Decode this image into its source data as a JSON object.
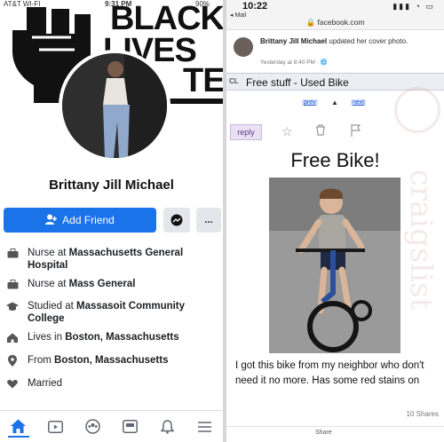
{
  "left_panel": {
    "status_bar": {
      "carrier": "AT&T WI-FI",
      "time": "9:31 PM",
      "battery": "90%"
    },
    "cover": {
      "line1": "BLACK",
      "line2": "LIVES",
      "line3": "TER"
    },
    "profile_name": "Brittany Jill Michael",
    "buttons": {
      "add_friend": "Add Friend",
      "more": "..."
    },
    "info": [
      {
        "icon": "briefcase-icon",
        "prefix": "Nurse at ",
        "bold": "Massachusetts General Hospital"
      },
      {
        "icon": "briefcase-icon",
        "prefix": "Nurse at ",
        "bold": "Mass General"
      },
      {
        "icon": "graduation-cap-icon",
        "prefix": "Studied at ",
        "bold": "Massasoit Community College"
      },
      {
        "icon": "home-icon",
        "prefix": "Lives in ",
        "bold": "Boston, Massachusetts"
      },
      {
        "icon": "location-pin-icon",
        "prefix": "From ",
        "bold": "Boston, Massachusetts"
      },
      {
        "icon": "heart-icon",
        "prefix": "Married",
        "bold": ""
      }
    ]
  },
  "right_panel": {
    "status": {
      "time": "10:22",
      "back": "◂ Mail"
    },
    "url": "🔒 facebook.com",
    "post": {
      "author": "Brittany Jill Michael",
      "action": " updated her cover photo.",
      "time": "Yesterday at 8:40 PM · 🌐"
    },
    "craigslist": {
      "badge": "CL",
      "title": "Free stuff - Used Bike",
      "prev": "prev",
      "up": "▲",
      "next": "next",
      "reply": "reply"
    },
    "listing_title": "Free Bike!",
    "listing_body": "I got this bike from my neighbor who don't need it no more. Has some red stains on",
    "shares": "10 Shares",
    "share_label": "Share",
    "watermark": "craigslist"
  },
  "colors": {
    "facebook_blue": "#1a73e8",
    "reply_purple": "#eae0f4"
  }
}
